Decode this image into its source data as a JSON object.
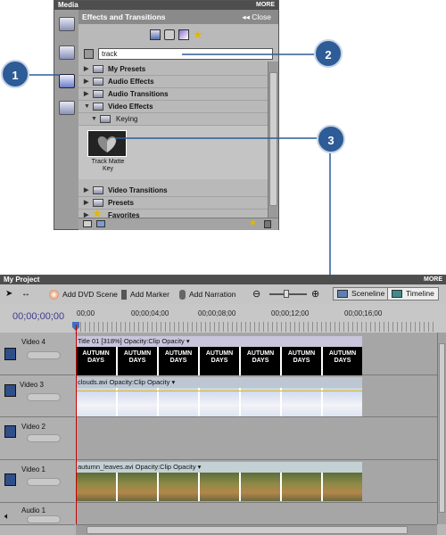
{
  "media_panel": {
    "title": "Media",
    "more_label": "MORE",
    "panel_title": "Effects and Transitions",
    "close_label": "Close",
    "search_value": "track",
    "tree": [
      {
        "label": "My Presets",
        "arrow": "▶",
        "selected": false
      },
      {
        "label": "Audio Effects",
        "arrow": "▶",
        "selected": false
      },
      {
        "label": "Audio Transitions",
        "arrow": "▶",
        "selected": false
      },
      {
        "label": "Video Effects",
        "arrow": "▼",
        "selected": false
      },
      {
        "label": "Keying",
        "arrow": "▼",
        "selected": false
      }
    ],
    "effect_item": {
      "label_line1": "Track Matte",
      "label_line2": "Key"
    },
    "tree_after": [
      {
        "label": "Video Transitions",
        "arrow": "▶"
      },
      {
        "label": "Presets",
        "arrow": "▶"
      },
      {
        "label": "Favorites",
        "arrow": "▶"
      }
    ]
  },
  "callouts": {
    "one": "1",
    "two": "2",
    "three": "3"
  },
  "project_panel": {
    "title": "My Project",
    "more_label": "MORE",
    "toolbar": {
      "add_dvd_scene": "Add DVD Scene",
      "add_marker": "Add Marker",
      "add_narration": "Add Narration",
      "sceneline": "Sceneline",
      "timeline": "Timeline"
    },
    "timecode": "00;00;00;00",
    "ruler_ticks": [
      "00;00",
      "00;00;04;00",
      "00;00;08;00",
      "00;00;12;00",
      "00;00;16;00"
    ],
    "tracks": [
      {
        "name": "Video 4",
        "clip": "Title 01 [318%]",
        "opacity": "Opacity:Clip Opacity"
      },
      {
        "name": "Video 3",
        "clip": "clouds.avi",
        "opacity": "Opacity:Clip Opacity"
      },
      {
        "name": "Video 2",
        "clip": "",
        "opacity": ""
      },
      {
        "name": "Video 1",
        "clip": "autumn_leaves.avi",
        "opacity": "Opacity:Clip Opacity"
      },
      {
        "name": "Audio 1",
        "clip": "",
        "opacity": ""
      }
    ],
    "title_frame_text": {
      "line1": "AUTUMN",
      "line2": "DAYS"
    }
  },
  "colors": {
    "callout": "#2d5c96",
    "title_bar": "#4e4e4e",
    "playhead": "#c00000"
  }
}
